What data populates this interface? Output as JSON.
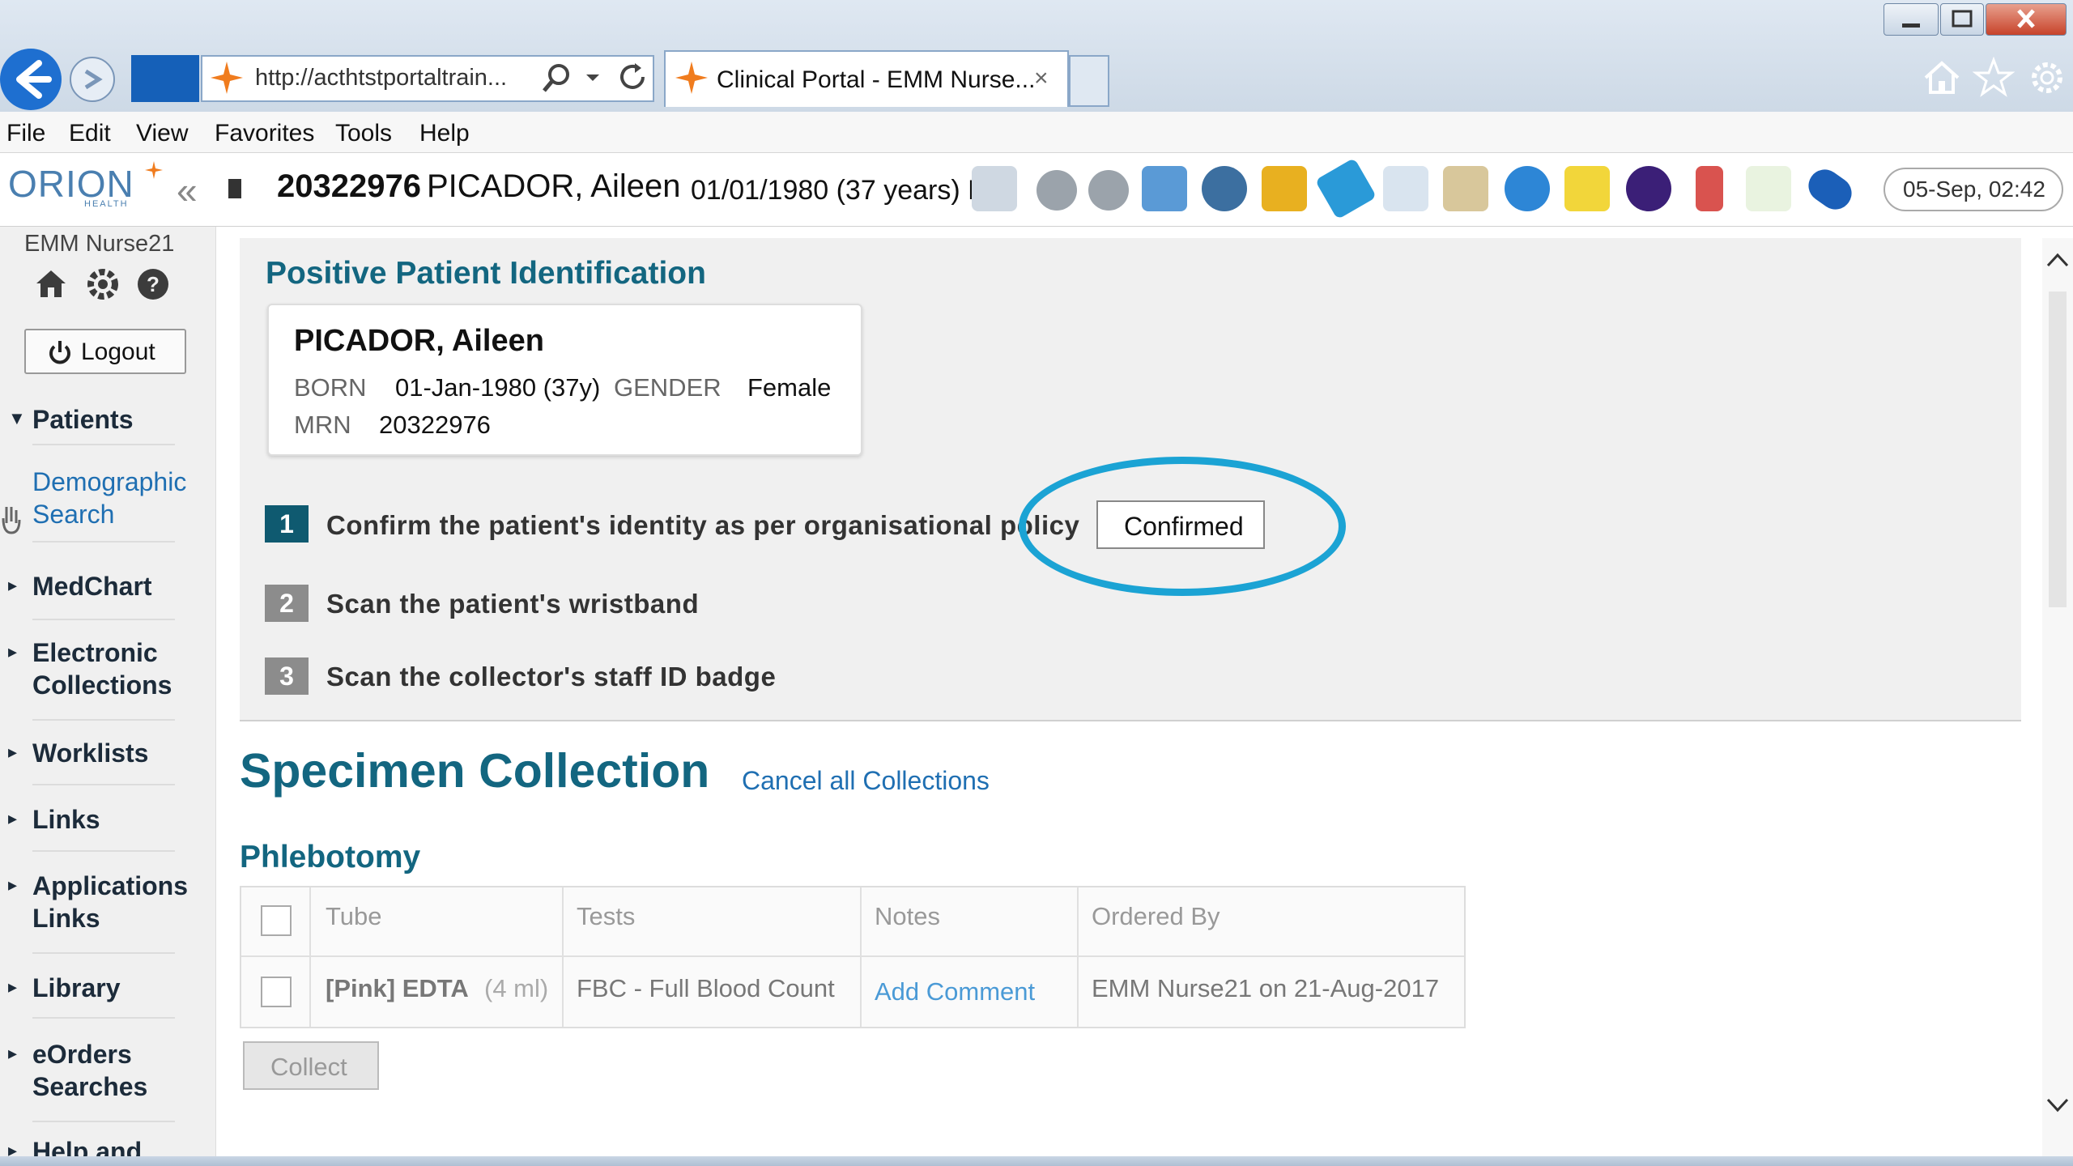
{
  "browser": {
    "url": "http://acthtstportaltrain...",
    "tab_title": "Clinical Portal - EMM Nurse...",
    "tab_close": "×",
    "menu": [
      "File",
      "Edit",
      "View",
      "Favorites",
      "Tools",
      "Help"
    ]
  },
  "header": {
    "logo": "ORION",
    "logo_sub": "HEALTH",
    "collapse_glyph": "«",
    "patient_mrn": "20322976",
    "patient_name": "PICADOR, Aileen",
    "patient_dob": "01/01/1980 (37 years) F",
    "datetime": "05-Sep, 02:42"
  },
  "sidebar": {
    "user": "EMM Nurse21",
    "logout": "Logout",
    "nav": [
      {
        "label": "Patients",
        "expanded": true
      },
      {
        "label": "MedChart"
      },
      {
        "label": "Electronic Collections"
      },
      {
        "label": "Worklists"
      },
      {
        "label": "Links"
      },
      {
        "label": "Applications Links"
      },
      {
        "label": "Library"
      },
      {
        "label": "eOrders Searches"
      },
      {
        "label": "Help and"
      }
    ],
    "demographic_search": "Demographic Search"
  },
  "ppi": {
    "title": "Positive Patient Identification",
    "card": {
      "name": "PICADOR, Aileen",
      "born_label": "BORN",
      "born_value": "01-Jan-1980 (37y)",
      "gender_label": "GENDER",
      "gender_value": "Female",
      "mrn_label": "MRN",
      "mrn_value": "20322976"
    },
    "steps": [
      {
        "num": "1",
        "text": "Confirm the patient's identity as per organisational policy",
        "active": true
      },
      {
        "num": "2",
        "text": "Scan the patient's wristband",
        "active": false
      },
      {
        "num": "3",
        "text": "Scan the collector's staff ID badge",
        "active": false
      }
    ],
    "confirmed_label": "Confirmed"
  },
  "specimen": {
    "title": "Specimen Collection",
    "cancel_all": "Cancel all Collections",
    "section": "Phlebotomy",
    "columns": [
      "Tube",
      "Tests",
      "Notes",
      "Ordered By"
    ],
    "rows": [
      {
        "tube": "[Pink] EDTA",
        "tube_volume": "(4 ml)",
        "tests": "FBC - Full Blood Count",
        "notes": "Add Comment",
        "ordered_by": "EMM Nurse21 on 21-Aug-2017"
      }
    ],
    "collect": "Collect"
  },
  "colors": {
    "accent": "#136680",
    "link": "#1f6fb2",
    "highlight_circle": "#1ba3d4",
    "step_active": "#0f5a70",
    "step_inactive": "#8c8c8c"
  }
}
